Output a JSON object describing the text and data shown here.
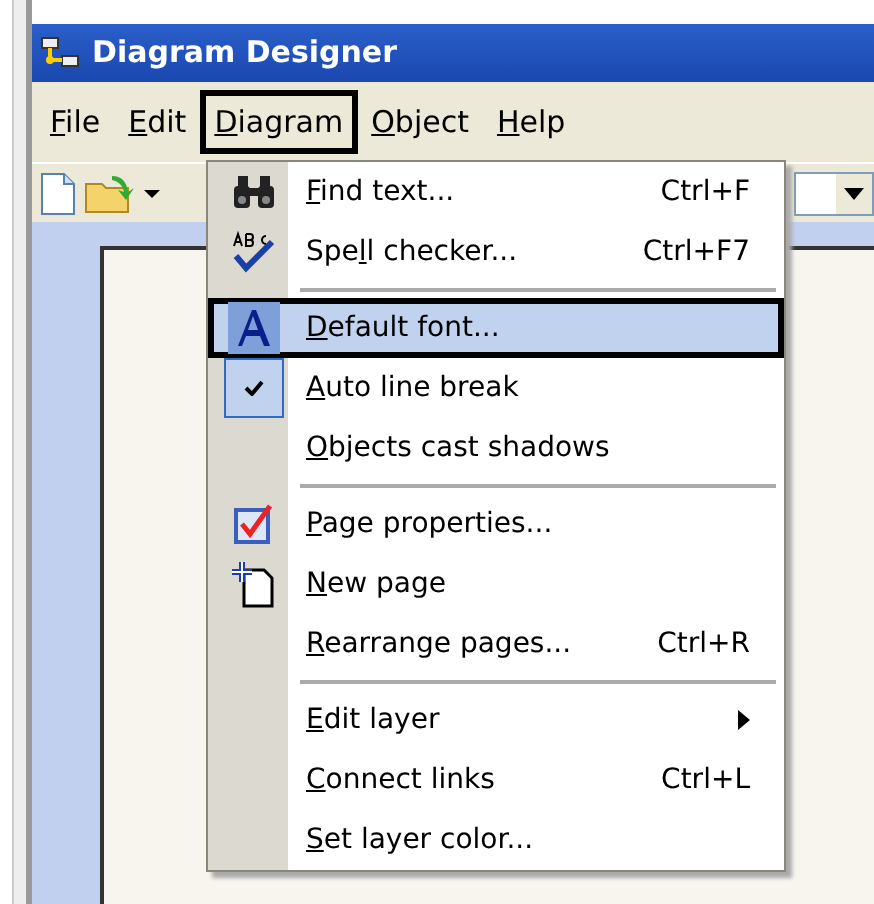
{
  "window": {
    "title": "Diagram Designer"
  },
  "menubar": [
    {
      "key": "F",
      "after": "ile",
      "selected": false
    },
    {
      "key": "E",
      "after": "dit",
      "selected": false
    },
    {
      "key": "D",
      "after": "iagram",
      "selected": true
    },
    {
      "key": "O",
      "after": "bject",
      "selected": false
    },
    {
      "key": "H",
      "after": "elp",
      "selected": false
    }
  ],
  "menu": [
    {
      "kind": "item",
      "key": "F",
      "after": "ind text...",
      "shortcut": "Ctrl+F",
      "selected": false,
      "checked": false
    },
    {
      "kind": "item",
      "before": "Spe",
      "key": "l",
      "after": "l checker...",
      "shortcut": "Ctrl+F7",
      "selected": false,
      "checked": false
    },
    {
      "kind": "separator"
    },
    {
      "kind": "item",
      "key": "D",
      "after": "efault font...",
      "selected": true,
      "checked": false
    },
    {
      "kind": "item",
      "key": "A",
      "after": "uto line break",
      "selected": false,
      "checked": true
    },
    {
      "kind": "item",
      "key": "O",
      "after": "bjects cast shadows",
      "selected": false,
      "checked": false
    },
    {
      "kind": "separator"
    },
    {
      "kind": "item",
      "key": "P",
      "after": "age properties...",
      "selected": false,
      "checked": false
    },
    {
      "kind": "item",
      "key": "N",
      "after": "ew page",
      "selected": false,
      "checked": false
    },
    {
      "kind": "item",
      "key": "R",
      "after": "earrange pages...",
      "shortcut": "Ctrl+R",
      "selected": false,
      "checked": false
    },
    {
      "kind": "separator"
    },
    {
      "kind": "item",
      "key": "E",
      "after": "dit layer",
      "submenu": true,
      "selected": false,
      "checked": false
    },
    {
      "kind": "item",
      "key": "C",
      "after": "onnect links",
      "shortcut": "Ctrl+L",
      "selected": false,
      "checked": false
    },
    {
      "kind": "item",
      "key": "S",
      "after": "et layer color...",
      "selected": false,
      "checked": false
    }
  ]
}
